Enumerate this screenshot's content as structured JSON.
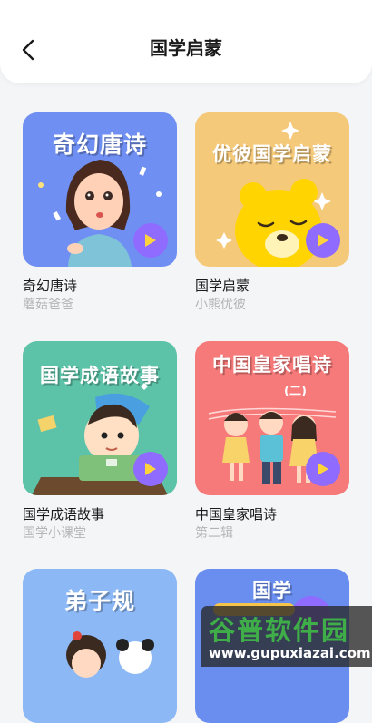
{
  "header": {
    "title": "国学启蒙"
  },
  "cards": [
    {
      "thumb_title": "奇幻唐诗",
      "title": "奇幻唐诗",
      "subtitle": "蘑菇爸爸",
      "bg": "#6f8ff2"
    },
    {
      "thumb_title": "优彼国学启蒙",
      "title": "国学启蒙",
      "subtitle": "小熊优彼",
      "bg": "#f5c97a"
    },
    {
      "thumb_title": "国学成语故事",
      "title": "国学成语故事",
      "subtitle": "国学小课堂",
      "bg": "#5cc3a8"
    },
    {
      "thumb_title": "中国皇家唱诗",
      "thumb_title_2": "(二)",
      "title": "中国皇家唱诗",
      "subtitle": "第二辑",
      "bg": "#f77a7a"
    },
    {
      "thumb_title": "弟子规",
      "bg": "#8cb8f5"
    },
    {
      "thumb_title": "国学",
      "bg": "#6a8ef0"
    }
  ],
  "watermark": {
    "main": "谷普软件园",
    "url": "www.gupuxiazai.com"
  },
  "colors": {
    "play": "#8f6bff",
    "subtitle": "#b4b4b4"
  }
}
